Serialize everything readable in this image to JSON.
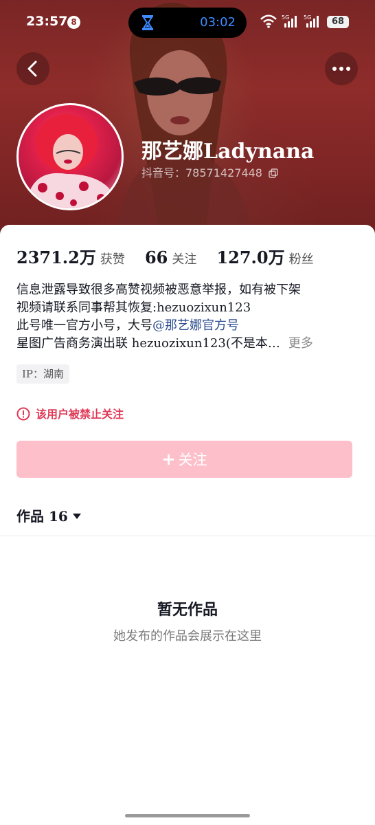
{
  "status_bar": {
    "time": "23:57",
    "notification_count": "8",
    "island_timer": "03:02",
    "network_1": "5G",
    "network_2": "5G",
    "battery": "68"
  },
  "profile": {
    "name": "那艺娜Ladynana",
    "douyin_id": "抖音号：78571427448"
  },
  "stats": [
    {
      "value": "2371.2万",
      "label": "获赞"
    },
    {
      "value": "66",
      "label": "关注"
    },
    {
      "value": "127.0万",
      "label": "粉丝"
    }
  ],
  "bio": {
    "line1": "信息泄露导致很多高赞视频被恶意举报，如有被下架",
    "line2": "视频请联系同事帮其恢复:hezuozixun123",
    "line3_prefix": "此号唯一官方小号，大号",
    "line3_mention": "@那艺娜官方号",
    "line4": "星图广告商务演出联 hezuozixun123(不是本…",
    "more": "更多"
  },
  "ip_tag": "IP：湖南",
  "ban_notice": "该用户被禁止关注",
  "follow_button": {
    "label": "关注"
  },
  "works_tab": {
    "label": "作品 16"
  },
  "empty_state": {
    "title": "暂无作品",
    "subtitle": "她发布的作品会展示在这里"
  },
  "colors": {
    "header_bg": "#8e2c2a",
    "follow_button_bg": "#fdbfc9",
    "ban_text": "#e03a58",
    "mention": "#2a4b8d"
  }
}
